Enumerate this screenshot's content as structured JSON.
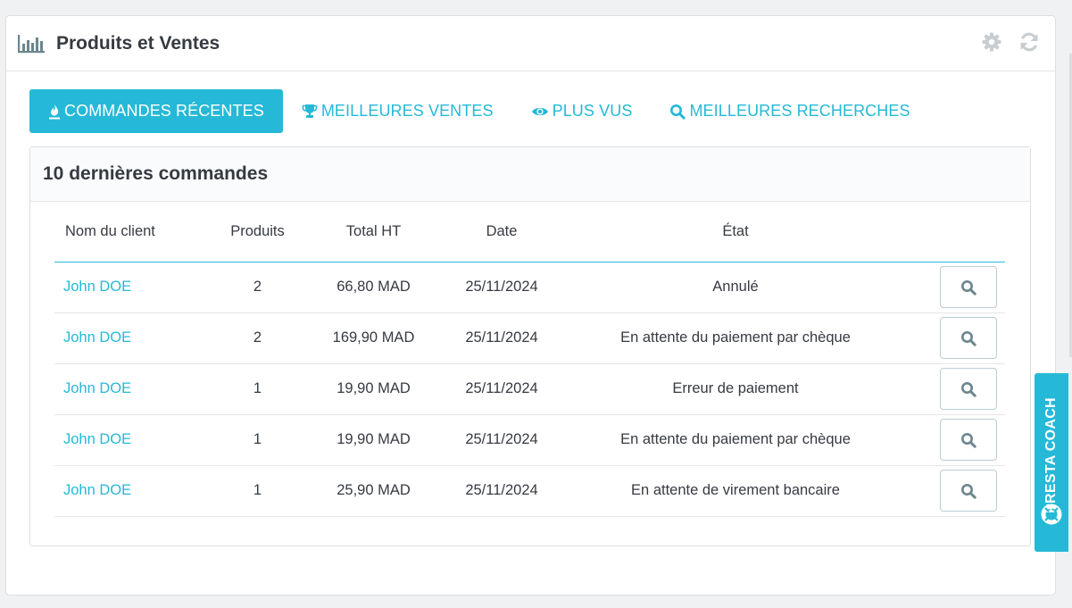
{
  "panel": {
    "title": "Produits et Ventes",
    "icons": [
      "bar-chart-icon",
      "gear-icon",
      "refresh-icon"
    ]
  },
  "tabs": [
    {
      "label": "COMMANDES RÉCENTES",
      "icon": "fire-icon",
      "active": true
    },
    {
      "label": "MEILLEURES VENTES",
      "icon": "trophy-icon",
      "active": false
    },
    {
      "label": "PLUS VUS",
      "icon": "eye-icon",
      "active": false
    },
    {
      "label": "MEILLEURES RECHERCHES",
      "icon": "search-icon",
      "active": false
    }
  ],
  "orders": {
    "title": "10 dernières commandes",
    "columns": [
      "Nom du client",
      "Produits",
      "Total HT",
      "Date",
      "État"
    ],
    "rows": [
      {
        "client": "John DOE",
        "products": "2",
        "total": "66,80 MAD",
        "date": "25/11/2024",
        "state": "Annulé"
      },
      {
        "client": "John DOE",
        "products": "2",
        "total": "169,90 MAD",
        "date": "25/11/2024",
        "state": "En attente du paiement par chèque"
      },
      {
        "client": "John DOE",
        "products": "1",
        "total": "19,90 MAD",
        "date": "25/11/2024",
        "state": "Erreur de paiement"
      },
      {
        "client": "John DOE",
        "products": "1",
        "total": "19,90 MAD",
        "date": "25/11/2024",
        "state": "En attente du paiement par chèque"
      },
      {
        "client": "John DOE",
        "products": "1",
        "total": "25,90 MAD",
        "date": "25/11/2024",
        "state": "En attente de virement bancaire"
      }
    ]
  },
  "coach": {
    "label": "PRESTA COACH",
    "icon": "lifebuoy-icon"
  },
  "colors": {
    "accent": "#25b9d7",
    "text": "#363a41",
    "border": "#dbe0e3"
  }
}
